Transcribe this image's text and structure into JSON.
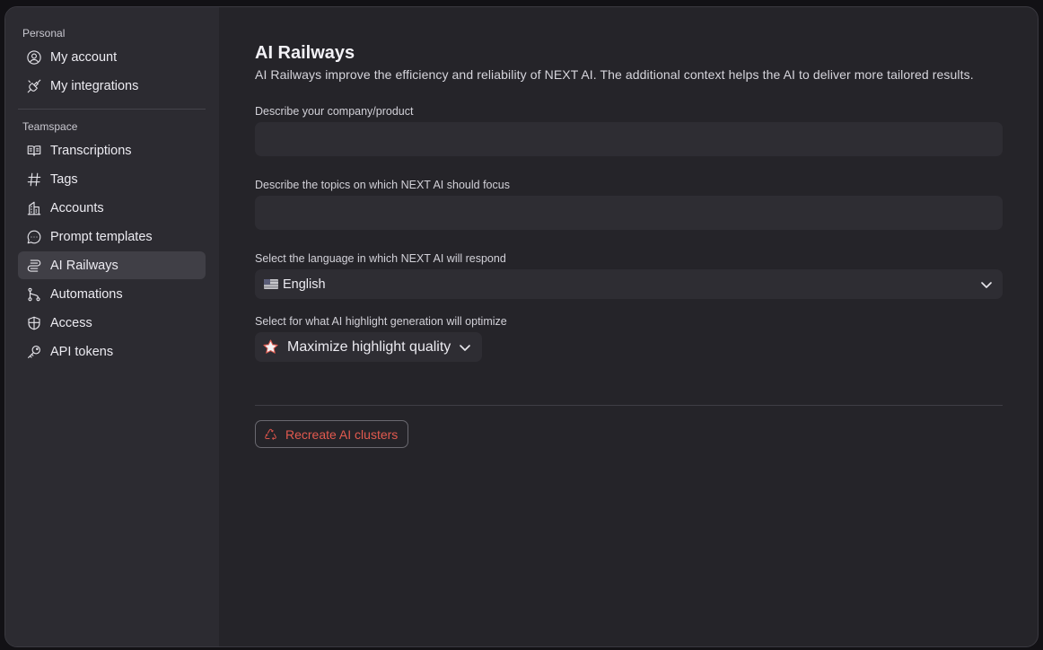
{
  "sidebar": {
    "personal_title": "Personal",
    "personal_items": [
      {
        "label": "My account",
        "icon": "user-circle-icon"
      },
      {
        "label": "My integrations",
        "icon": "plug-icon"
      }
    ],
    "teamspace_title": "Teamspace",
    "teamspace_items": [
      {
        "label": "Transcriptions",
        "icon": "book-open-icon"
      },
      {
        "label": "Tags",
        "icon": "hash-icon"
      },
      {
        "label": "Accounts",
        "icon": "building-icon"
      },
      {
        "label": "Prompt templates",
        "icon": "chat-bubble-icon"
      },
      {
        "label": "AI Railways",
        "icon": "route-icon",
        "active": true
      },
      {
        "label": "Automations",
        "icon": "git-branch-icon"
      },
      {
        "label": "Access",
        "icon": "shield-icon"
      },
      {
        "label": "API tokens",
        "icon": "key-icon"
      }
    ]
  },
  "main": {
    "title": "AI Railways",
    "description": "AI Railways improve the efficiency and reliability of NEXT AI. The additional context helps the AI to deliver more tailored results.",
    "company_field": {
      "label": "Describe your company/product",
      "value": "",
      "placeholder": ""
    },
    "topics_field": {
      "label": "Describe the topics on which NEXT AI should focus",
      "value": "",
      "placeholder": ""
    },
    "language_field": {
      "label": "Select the language in which NEXT AI will respond",
      "value": "English",
      "flag": "us-flag-icon"
    },
    "highlight_field": {
      "label": "Select for what AI highlight generation will optimize",
      "value": "Maximize highlight quality",
      "icon": "star-icon"
    },
    "recreate_button": {
      "label": "Recreate AI clusters",
      "icon": "recycle-icon"
    }
  },
  "colors": {
    "background": "#252429",
    "sidebar": "#2c2b31",
    "active_item": "#403f46",
    "input": "#2e2d33",
    "danger": "#e25a4f"
  }
}
